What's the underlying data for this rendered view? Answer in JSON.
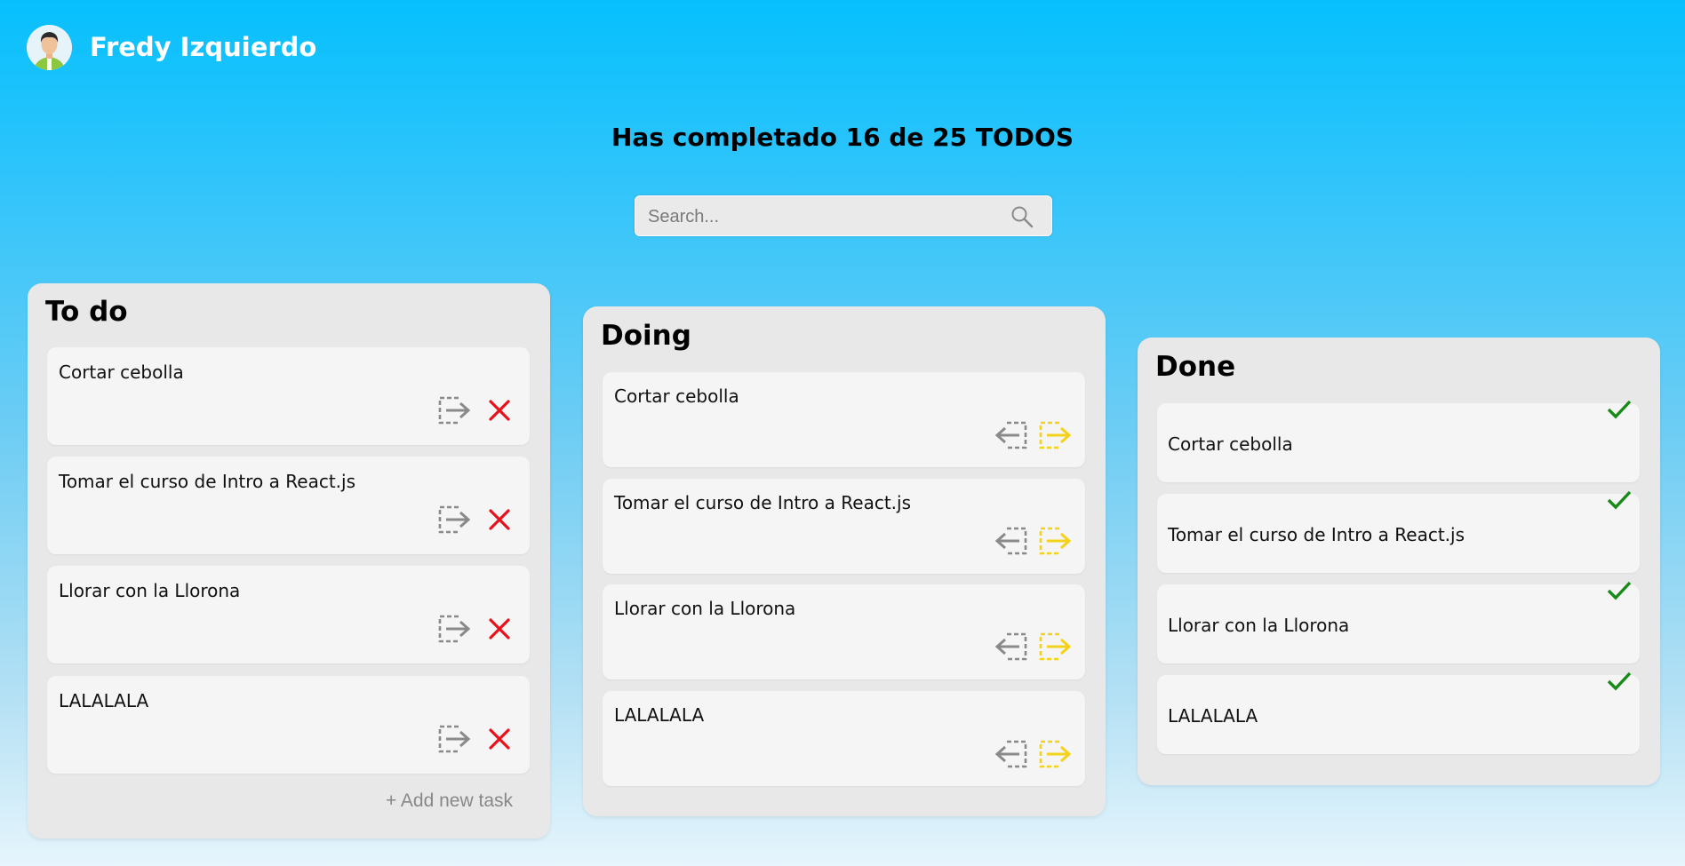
{
  "header": {
    "user_name": "Fredy Izquierdo"
  },
  "counter_text": "Has completado 16 de 25 TODOS",
  "search": {
    "placeholder": "Search...",
    "value": ""
  },
  "columns": {
    "todo": {
      "title": "To do",
      "add_label": "+ Add new task",
      "cards": [
        "Cortar cebolla",
        "Tomar el curso de Intro a React.js",
        "Llorar con la Llorona",
        "LALALALA"
      ]
    },
    "doing": {
      "title": "Doing",
      "cards": [
        "Cortar cebolla",
        "Tomar el curso de Intro a React.js",
        "Llorar con la Llorona",
        "LALALALA"
      ]
    },
    "done": {
      "title": "Done",
      "cards": [
        "Cortar cebolla",
        "Tomar el curso de Intro a React.js",
        "Llorar con la Llorona",
        "LALALALA"
      ]
    }
  },
  "icons": {
    "move_right": "move-right-icon",
    "move_left": "move-left-icon",
    "delete": "delete-x-icon",
    "done_check": "check-icon",
    "search": "search-icon"
  },
  "colors": {
    "delete": "#e8101a",
    "move_forward": "#f5d21a",
    "move_inactive": "#8a8a8a",
    "check": "#188a18"
  }
}
